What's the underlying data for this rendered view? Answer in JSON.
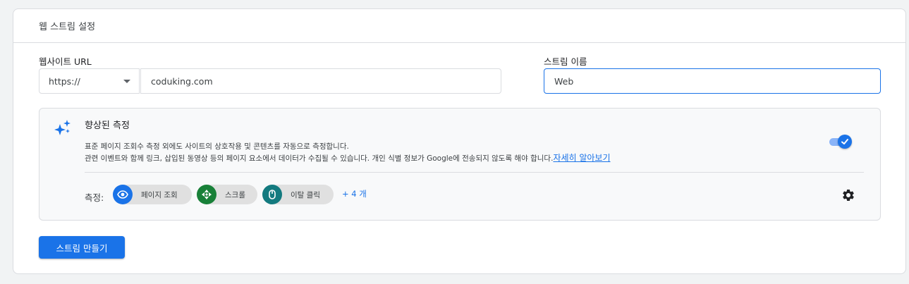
{
  "header": {
    "title": "웹 스트림 설정"
  },
  "website_url": {
    "label": "웹사이트 URL",
    "protocol": "https://",
    "value": "coduking.com"
  },
  "stream_name": {
    "label": "스트림 이름",
    "value": "Web"
  },
  "enhanced": {
    "title": "향상된 측정",
    "desc_line1": "표준 페이지 조회수 측정 외에도 사이트의 상호작용 및 콘텐츠를 자동으로 측정합니다.",
    "desc_line2": "관련 이벤트와 함께 링크, 삽입된 동영상 등의 페이지 요소에서 데이터가 수집될 수 있습니다. 개인 식별 정보가 Google에 전송되지 않도록 해야 합니다.",
    "learn_more": "자세히 알아보기",
    "toggle_on": true,
    "measure_label": "측정:",
    "chips": [
      {
        "label": "페이지 조회",
        "icon": "eye-icon",
        "color": "#1a73e8"
      },
      {
        "label": "스크롤",
        "icon": "scroll-icon",
        "color": "#188038"
      },
      {
        "label": "이탈 클릭",
        "icon": "mouse-icon",
        "color": "#137a7f"
      }
    ],
    "more_label": "+ 4 개"
  },
  "actions": {
    "create_label": "스트림 만들기"
  },
  "colors": {
    "accent": "#1a73e8",
    "green": "#188038",
    "teal": "#137a7f"
  }
}
